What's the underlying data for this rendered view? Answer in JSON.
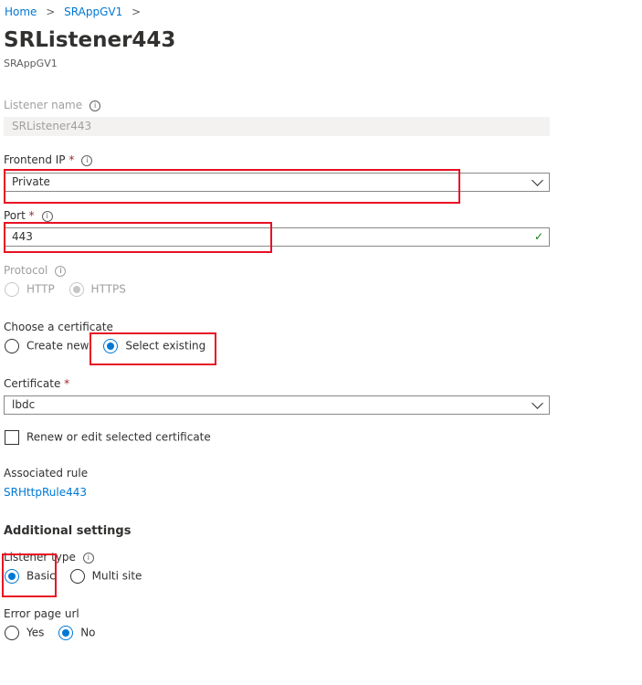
{
  "breadcrumb": {
    "home": "Home",
    "parent": "SRAppGV1"
  },
  "title": "SRListener443",
  "subtitle": "SRAppGV1",
  "listener_name": {
    "label": "Listener name",
    "value": "SRListener443"
  },
  "frontend_ip": {
    "label": "Frontend IP",
    "required": "*",
    "value": "Private"
  },
  "port": {
    "label": "Port",
    "required": "*",
    "value": "443"
  },
  "protocol": {
    "label": "Protocol",
    "options": [
      "HTTP",
      "HTTPS"
    ],
    "selected": "HTTPS"
  },
  "choose_cert": {
    "label": "Choose a certificate",
    "options": [
      "Create new",
      "Select existing"
    ],
    "selected": "Select existing"
  },
  "certificate": {
    "label": "Certificate",
    "required": "*",
    "value": "lbdc"
  },
  "renew": {
    "label": "Renew or edit selected certificate",
    "checked": false
  },
  "associated_rule": {
    "label": "Associated rule",
    "value": "SRHttpRule443"
  },
  "additional_settings": "Additional settings",
  "listener_type": {
    "label": "Listener type",
    "options": [
      "Basic",
      "Multi site"
    ],
    "selected": "Basic"
  },
  "error_page": {
    "label": "Error page url",
    "options": [
      "Yes",
      "No"
    ],
    "selected": "No"
  },
  "colors": {
    "accent": "#0078d4",
    "highlight": "#e81123",
    "valid": "#107c10"
  }
}
